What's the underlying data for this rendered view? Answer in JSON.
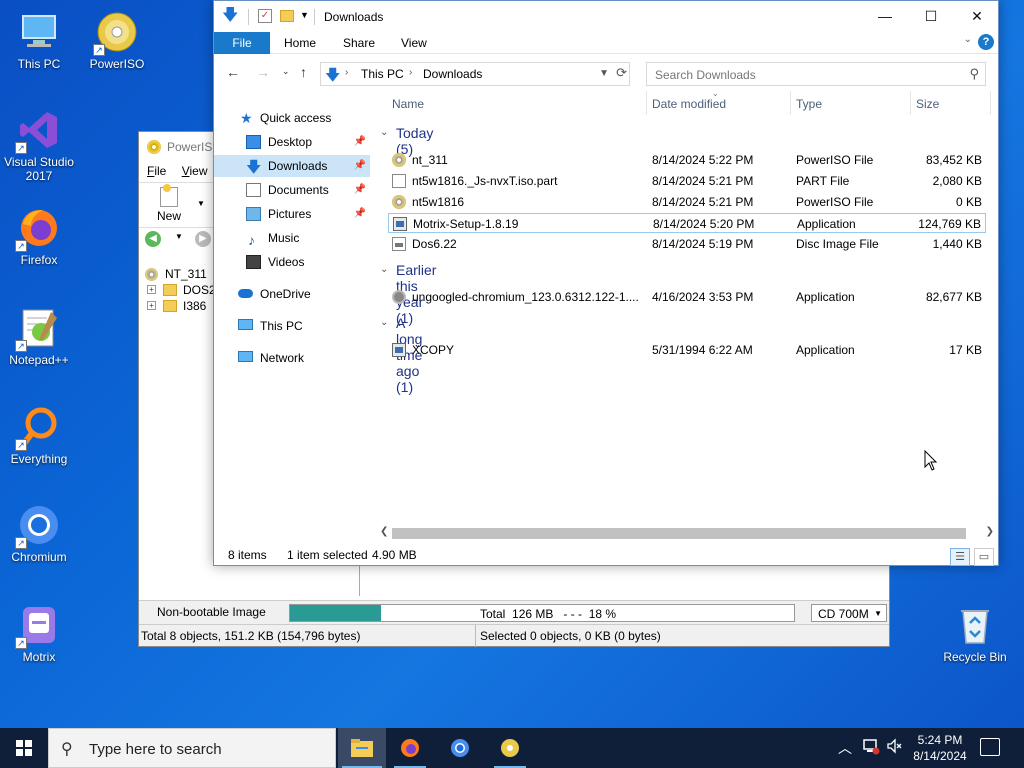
{
  "desktop": {
    "icons": [
      {
        "label": "This PC"
      },
      {
        "label": "PowerISO"
      },
      {
        "label": "Visual Studio 2017"
      },
      {
        "label": "Firefox"
      },
      {
        "label": "Notepad++"
      },
      {
        "label": "Everything"
      },
      {
        "label": "Chromium"
      },
      {
        "label": "Motrix"
      },
      {
        "label": "Recycle Bin"
      }
    ]
  },
  "poweriso": {
    "title": "PowerISO",
    "menu": [
      "File",
      "View"
    ],
    "new_label": "New",
    "tree": {
      "root": "NT_311",
      "children": [
        "DOS2",
        "I386"
      ]
    },
    "image_type": "Non-bootable Image",
    "total_label": "Total  126 MB   - - -  18 %",
    "progress_percent": 18,
    "media": "CD 700M",
    "status_left": "Total 8 objects, 151.2 KB (154,796 bytes)",
    "status_right": "Selected 0 objects, 0 KB (0 bytes)"
  },
  "explorer": {
    "title": "Downloads",
    "ribbon_tabs": [
      "File",
      "Home",
      "Share",
      "View"
    ],
    "breadcrumb": [
      "This PC",
      "Downloads"
    ],
    "search_placeholder": "Search Downloads",
    "nav": {
      "quick_access": "Quick access",
      "items": [
        "Desktop",
        "Downloads",
        "Documents",
        "Pictures",
        "Music",
        "Videos"
      ],
      "onedrive": "OneDrive",
      "this_pc": "This PC",
      "network": "Network"
    },
    "columns": {
      "name": "Name",
      "date": "Date modified",
      "type": "Type",
      "size": "Size"
    },
    "groups": [
      {
        "label": "Today (5)",
        "files": [
          {
            "name": "nt_311",
            "date": "8/14/2024 5:22 PM",
            "type": "PowerISO File",
            "size": "83,452 KB",
            "icon": "disc-icon"
          },
          {
            "name": "nt5w1816._Js-nvxT.iso.part",
            "date": "8/14/2024 5:21 PM",
            "type": "PART File",
            "size": "2,080 KB",
            "icon": "file-icon"
          },
          {
            "name": "nt5w1816",
            "date": "8/14/2024 5:21 PM",
            "type": "PowerISO File",
            "size": "0 KB",
            "icon": "disc-icon"
          },
          {
            "name": "Motrix-Setup-1.8.19",
            "date": "8/14/2024 5:20 PM",
            "type": "Application",
            "size": "124,769 KB",
            "icon": "app-icon"
          },
          {
            "name": "Dos6.22",
            "date": "8/14/2024 5:19 PM",
            "type": "Disc Image File",
            "size": "1,440 KB",
            "icon": "disc-image-icon"
          }
        ]
      },
      {
        "label": "Earlier this year (1)",
        "files": [
          {
            "name": "ungoogled-chromium_123.0.6312.122-1....",
            "date": "4/16/2024 3:53 PM",
            "type": "Application",
            "size": "82,677 KB",
            "icon": "installer-icon"
          }
        ]
      },
      {
        "label": "A long time ago (1)",
        "files": [
          {
            "name": "XCOPY",
            "date": "5/31/1994 6:22 AM",
            "type": "Application",
            "size": "17 KB",
            "icon": "app-icon"
          }
        ]
      }
    ],
    "status_items": "8 items",
    "status_selected": "1 item selected",
    "status_size": "4.90 MB"
  },
  "taskbar": {
    "search_placeholder": "Type here to search",
    "time": "5:24 PM",
    "date": "8/14/2024"
  }
}
